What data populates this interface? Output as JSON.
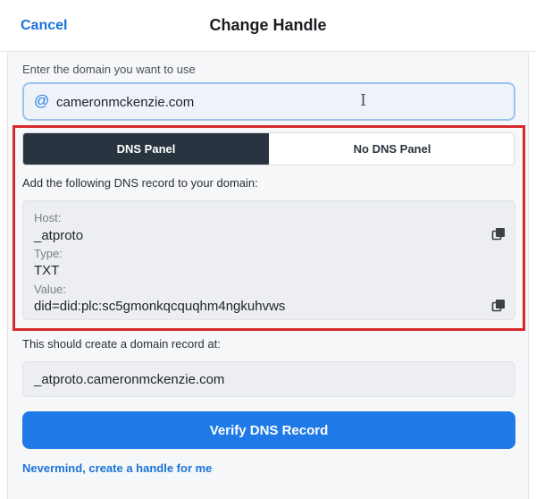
{
  "header": {
    "cancel_label": "Cancel",
    "title": "Change Handle"
  },
  "domain": {
    "label": "Enter the domain you want to use",
    "at_symbol": "@",
    "value": "cameronmckenzie.com",
    "cursor_glyph": "I"
  },
  "dns_toggle": {
    "options": [
      "DNS Panel",
      "No DNS Panel"
    ],
    "selected": "DNS Panel"
  },
  "instructions": "Add the following DNS record to your domain:",
  "record": {
    "host_label": "Host:",
    "host_value": "_atproto",
    "type_label": "Type:",
    "type_value": "TXT",
    "value_label": "Value:",
    "value_value": "did=did:plc:sc5gmonkqcquqhm4ngkuhvws"
  },
  "result": {
    "label": "This should create a domain record at:",
    "value": "_atproto.cameronmckenzie.com"
  },
  "verify_label": "Verify DNS Record",
  "nevermind_label": "Nevermind, create a handle for me",
  "colors": {
    "accent": "#1f7ae8",
    "link": "#1a73d9",
    "toggle_active": "#2a3440",
    "highlight": "#d62b2b"
  },
  "icons": {
    "at": "at-icon",
    "text_cursor": "text-cursor-icon",
    "copy": "copy-icon"
  }
}
